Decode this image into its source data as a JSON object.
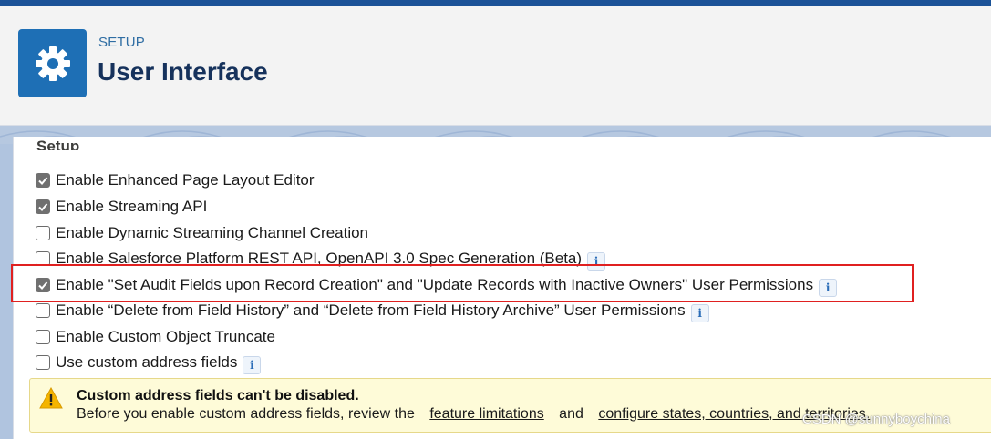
{
  "header": {
    "eyebrow": "SETUP",
    "title": "User Interface",
    "icon": "gear-icon"
  },
  "section": {
    "title": "Setup"
  },
  "options": [
    {
      "label": "Enable Enhanced Page Layout Editor",
      "checked": true,
      "info": false
    },
    {
      "label": "Enable Streaming API",
      "checked": true,
      "info": false
    },
    {
      "label": "Enable Dynamic Streaming Channel Creation",
      "checked": false,
      "info": false
    },
    {
      "label": "Enable Salesforce Platform REST API, OpenAPI 3.0 Spec Generation (Beta)",
      "checked": false,
      "info": true
    },
    {
      "label": "Enable \"Set Audit Fields upon Record Creation\" and \"Update Records with Inactive Owners\" User Permissions",
      "checked": true,
      "info": true
    },
    {
      "label": "Enable “Delete from Field History” and “Delete from Field History Archive” User Permissions",
      "checked": false,
      "info": true
    },
    {
      "label": "Enable Custom Object Truncate",
      "checked": false,
      "info": false
    },
    {
      "label": "Use custom address fields",
      "checked": false,
      "info": true
    }
  ],
  "info_glyph": "i",
  "warning": {
    "icon": "warning-icon",
    "title": "Custom address fields can't be disabled.",
    "body_prefix": "Before you enable custom address fields, review the",
    "link1": "feature limitations",
    "conjunction": "and",
    "link2": "configure states, countries, and territories."
  },
  "watermark": "CSDN @sunnyboychina",
  "colors": {
    "brand": "#1b5297",
    "icon_bg": "#1e6fb5",
    "highlight": "#e02020",
    "warning_bg": "#fefbd8"
  }
}
